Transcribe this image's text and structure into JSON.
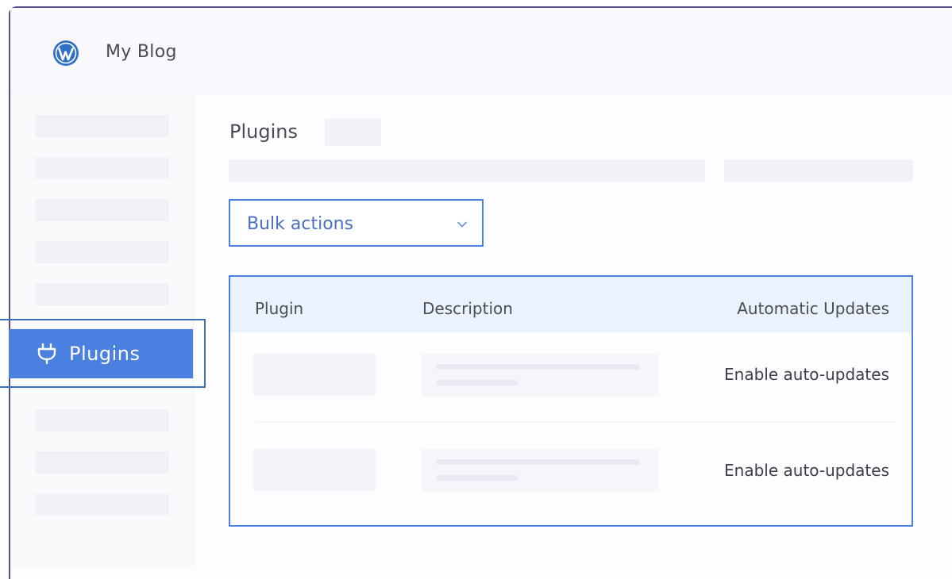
{
  "header": {
    "site_title": "My Blog",
    "logo_icon": "wordpress-logo"
  },
  "sidebar": {
    "active_item": {
      "label": "Plugins",
      "icon": "plug-icon"
    }
  },
  "main": {
    "page_title": "Plugins",
    "bulk_actions": {
      "selected": "Bulk actions",
      "icon": "chevron-down-icon"
    },
    "table": {
      "columns": [
        "Plugin",
        "Description",
        "Automatic Updates"
      ],
      "rows": [
        {
          "auto_update_link": "Enable auto-updates"
        },
        {
          "auto_update_link": "Enable auto-updates"
        }
      ]
    }
  },
  "colors": {
    "accent": "#4a80e0",
    "outline": "#3d6fb6",
    "table_header_bg": "#eaf3fd",
    "placeholder": "#f1f1f8"
  }
}
